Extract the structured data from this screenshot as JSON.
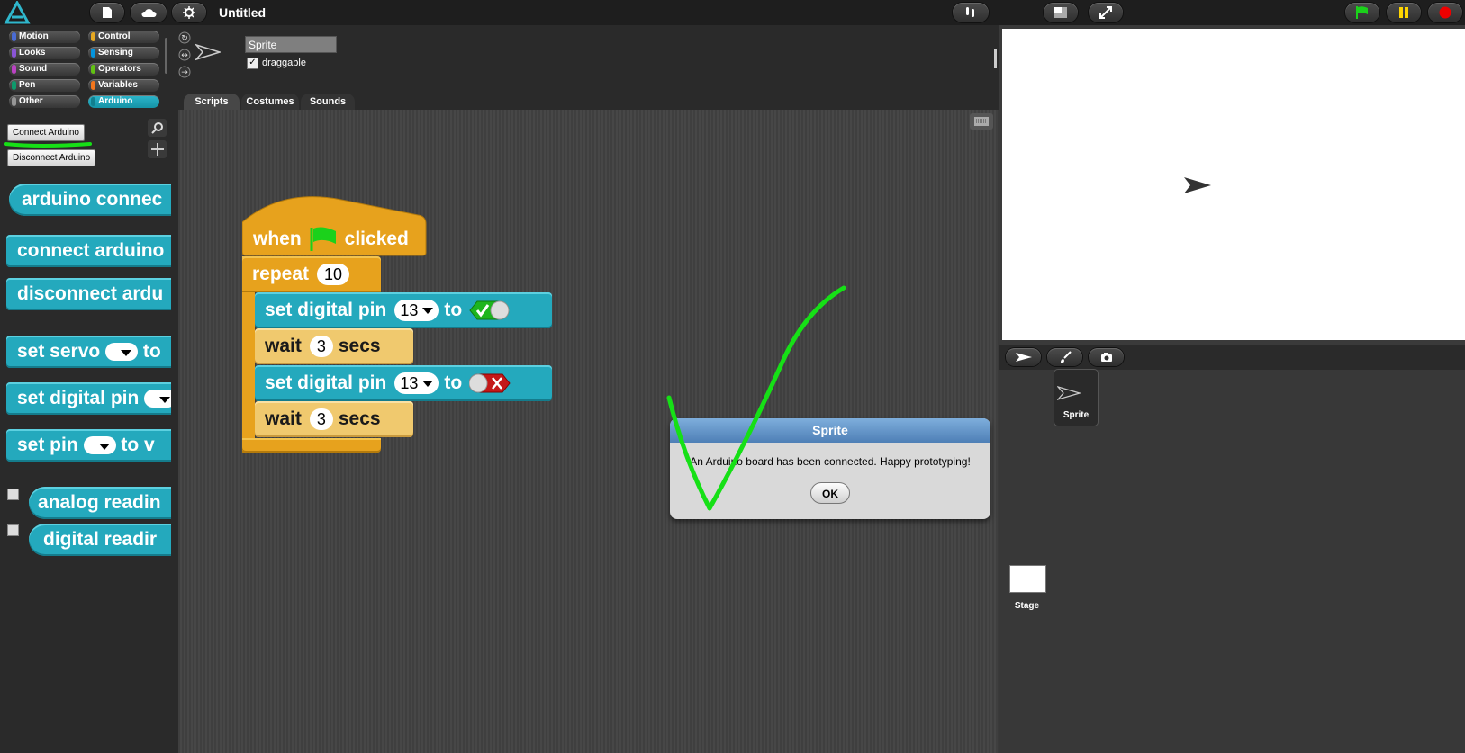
{
  "app": {
    "title": "Untitled"
  },
  "palette": {
    "categories": [
      {
        "label": "Motion",
        "color": "#4a6cd4"
      },
      {
        "label": "Looks",
        "color": "#8a55d7"
      },
      {
        "label": "Sound",
        "color": "#bb42c3"
      },
      {
        "label": "Pen",
        "color": "#0e9a6c"
      },
      {
        "label": "Other",
        "color": "#969696"
      },
      {
        "label": "Control",
        "color": "#e6a822"
      },
      {
        "label": "Sensing",
        "color": "#0494dc"
      },
      {
        "label": "Operators",
        "color": "#62c213"
      },
      {
        "label": "Variables",
        "color": "#f3761d"
      },
      {
        "label": "Arduino",
        "color": "#24a9bd"
      }
    ],
    "connect_button": "Connect Arduino",
    "disconnect_button": "Disconnect Arduino",
    "blocks": [
      "arduino connec",
      "connect arduino",
      "disconnect ardu",
      "set servo",
      "set digital pin",
      "set pin",
      "analog readin",
      "digital readir"
    ],
    "block_suffix_to": "to",
    "block_suffix_tv": "to v"
  },
  "sprite": {
    "name": "Sprite",
    "draggable_label": "draggable",
    "draggable": true
  },
  "tabs": [
    "Scripts",
    "Costumes",
    "Sounds"
  ],
  "script": {
    "hat": {
      "when": "when",
      "clicked": "clicked"
    },
    "repeat": {
      "label": "repeat",
      "count": "10"
    },
    "set1": {
      "label": "set digital pin",
      "pin": "13",
      "to": "to",
      "value": true
    },
    "wait1": {
      "label": "wait",
      "secs": "3",
      "unit": "secs"
    },
    "set2": {
      "label": "set digital pin",
      "pin": "13",
      "to": "to",
      "value": false
    },
    "wait2": {
      "label": "wait",
      "secs": "3",
      "unit": "secs"
    }
  },
  "dialog": {
    "title": "Sprite",
    "message": "An Arduino board has been connected. Happy prototyping!",
    "ok": "OK"
  },
  "corral": {
    "sprite_label": "Sprite",
    "stage_label": "Stage"
  },
  "colors": {
    "accent": "#24a9bd",
    "control": "#e7a21d",
    "annotation": "#16e016"
  }
}
